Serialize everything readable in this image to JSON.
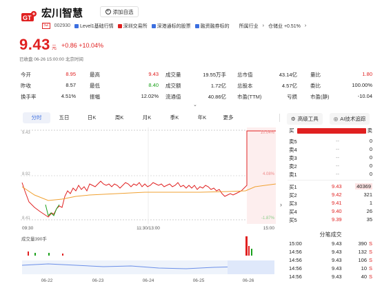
{
  "header": {
    "stock_name": "宏川智慧",
    "watch_label": "添加自选",
    "exchange_badge": "SZ",
    "code": "002930",
    "tags": [
      {
        "label": "Level1基础行情",
        "color": "#3c6fe0"
      },
      {
        "label": "深圳交易所",
        "color": "#e02020"
      },
      {
        "label": "深港通标的股票",
        "color": "#3c6fe0"
      },
      {
        "label": "融资融券标的",
        "color": "#3c6fe0"
      }
    ],
    "industry": "所属行业",
    "sector": "仓储业 +0.51%",
    "price": "9.43",
    "price_unit": "元",
    "change": "+0.86 +10.04%",
    "closed_text": "已收盘 06-26 15:00:00 北京时间"
  },
  "stats": [
    {
      "label": "今开",
      "value": "8.95",
      "color": "red"
    },
    {
      "label": "最高",
      "value": "9.43",
      "color": "red"
    },
    {
      "label": "成交量",
      "value": "19.55万手",
      "color": ""
    },
    {
      "label": "总市值",
      "value": "43.14亿",
      "color": ""
    },
    {
      "label": "量比",
      "value": "1.80",
      "color": "red"
    },
    {
      "label": "昨收",
      "value": "8.57",
      "color": ""
    },
    {
      "label": "最低",
      "value": "8.40",
      "color": "green"
    },
    {
      "label": "成交额",
      "value": "1.72亿",
      "color": ""
    },
    {
      "label": "总股本",
      "value": "4.57亿",
      "color": ""
    },
    {
      "label": "委比",
      "value": "100.00%",
      "color": ""
    },
    {
      "label": "换手率",
      "value": "4.51%",
      "color": ""
    },
    {
      "label": "振幅",
      "value": "12.02%",
      "color": ""
    },
    {
      "label": "流通值",
      "value": "40.86亿",
      "color": ""
    },
    {
      "label": "市盈(TTM)",
      "value": "亏损",
      "color": ""
    },
    {
      "label": "市盈(静)",
      "value": "-10.04",
      "color": ""
    }
  ],
  "tabs": [
    "分时",
    "五日",
    "日K",
    "周K",
    "月K",
    "季K",
    "年K",
    "更多"
  ],
  "tools": {
    "advanced": "高级工具",
    "ai": "AI技术追踪"
  },
  "chart": {
    "y_labels_left": [
      "9.43",
      "8.92",
      "8.41"
    ],
    "y_labels_right": [
      "10.04%",
      "4.08%",
      "-1.87%"
    ],
    "x_labels": [
      "09:30",
      "11:30/13:00",
      "15:00"
    ],
    "volume_label": "成交量390手",
    "five_day_labels": [
      "06-22",
      "06-23",
      "06-24",
      "06-25",
      "06-26"
    ]
  },
  "orderbook": {
    "buy_label": "买",
    "sell_label": "卖",
    "asks": [
      {
        "level": "卖5",
        "price": "--",
        "vol": "0"
      },
      {
        "level": "卖4",
        "price": "--",
        "vol": "0"
      },
      {
        "level": "卖3",
        "price": "--",
        "vol": "0"
      },
      {
        "level": "卖2",
        "price": "--",
        "vol": "0"
      },
      {
        "level": "卖1",
        "price": "--",
        "vol": "0"
      }
    ],
    "bids": [
      {
        "level": "买1",
        "price": "9.43",
        "vol": "40369"
      },
      {
        "level": "买2",
        "price": "9.42",
        "vol": "321"
      },
      {
        "level": "买3",
        "price": "9.41",
        "vol": "1"
      },
      {
        "level": "买4",
        "price": "9.40",
        "vol": "26"
      },
      {
        "level": "买5",
        "price": "9.39",
        "vol": "35"
      }
    ]
  },
  "trades": {
    "title": "分笔成交",
    "rows": [
      {
        "time": "15:00",
        "price": "9.43",
        "vol": "390",
        "side": "S"
      },
      {
        "time": "14:56",
        "price": "9.43",
        "vol": "132",
        "side": "S"
      },
      {
        "time": "14:56",
        "price": "9.43",
        "vol": "106",
        "side": "S"
      },
      {
        "time": "14:56",
        "price": "9.43",
        "vol": "10",
        "side": "S"
      },
      {
        "time": "14:56",
        "price": "9.43",
        "vol": "40",
        "side": "S"
      }
    ]
  }
}
